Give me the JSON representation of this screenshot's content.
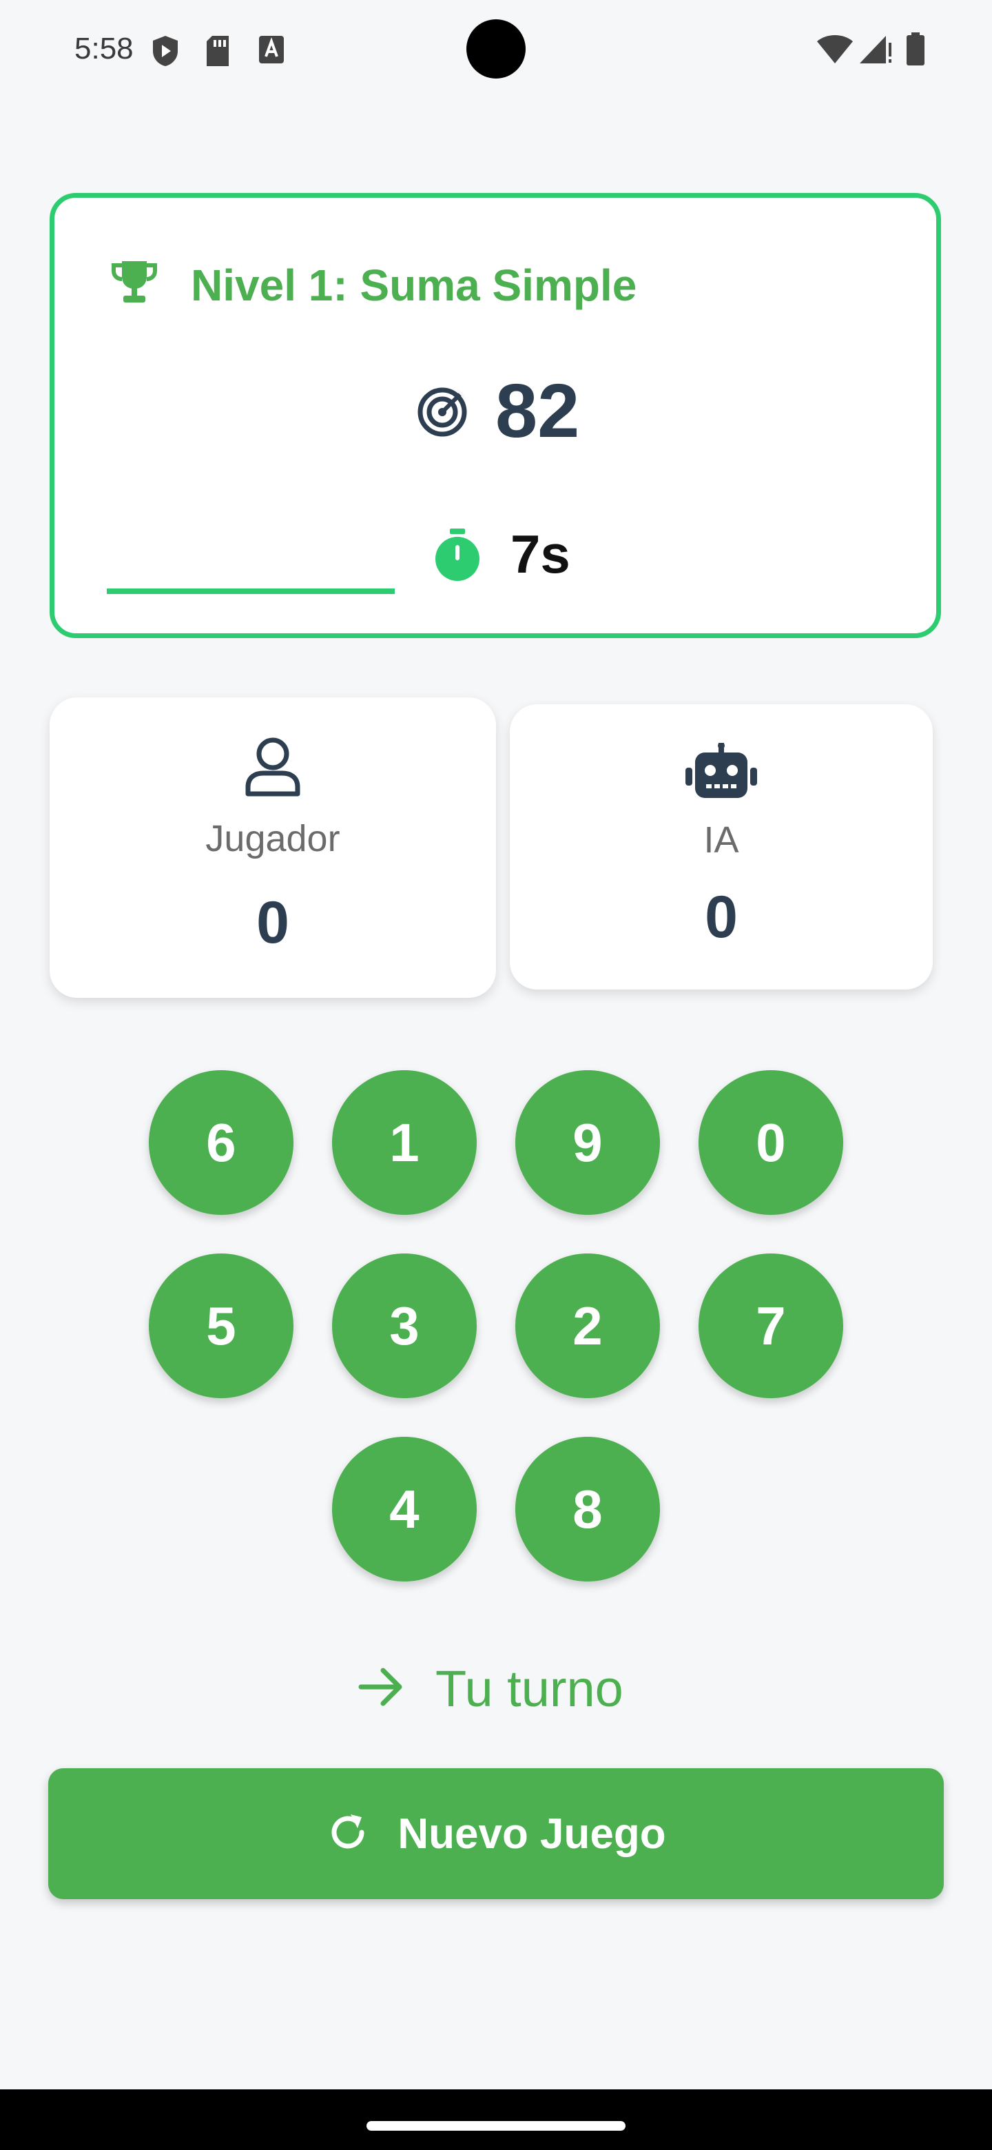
{
  "status_bar": {
    "time": "5:58"
  },
  "level": {
    "title": "Nivel 1: Suma Simple",
    "target": "82",
    "timer": "7s"
  },
  "scores": {
    "player": {
      "label": "Jugador",
      "value": "0"
    },
    "ai": {
      "label": "IA",
      "value": "0"
    }
  },
  "number_buttons": [
    "6",
    "1",
    "9",
    "0",
    "5",
    "3",
    "2",
    "7",
    "4",
    "8"
  ],
  "turn": {
    "label": "Tu turno"
  },
  "new_game": {
    "label": "Nuevo Juego"
  },
  "colors": {
    "primary": "#4caf50",
    "accent": "#2ecc71",
    "dark": "#2c3e50",
    "background": "#f6f7f9"
  }
}
